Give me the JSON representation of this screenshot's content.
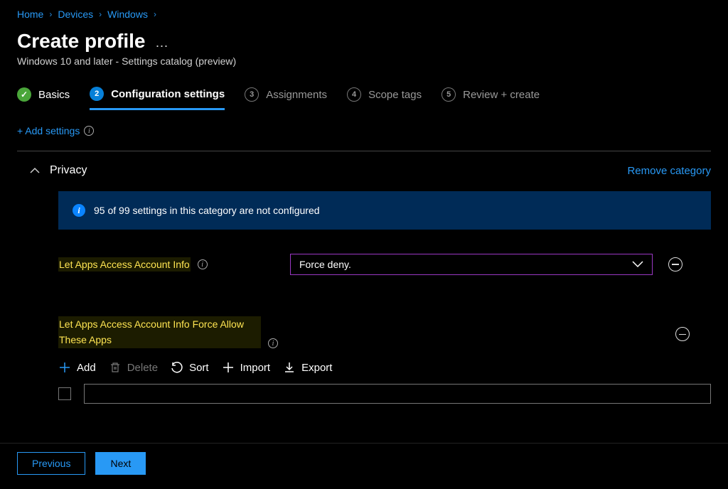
{
  "breadcrumb": {
    "items": [
      "Home",
      "Devices",
      "Windows"
    ]
  },
  "page": {
    "title": "Create profile",
    "subtitle": "Windows 10 and later - Settings catalog (preview)"
  },
  "wizard": {
    "steps": [
      {
        "label": "Basics"
      },
      {
        "num": "2",
        "label": "Configuration settings"
      },
      {
        "num": "3",
        "label": "Assignments"
      },
      {
        "num": "4",
        "label": "Scope tags"
      },
      {
        "num": "5",
        "label": "Review + create"
      }
    ]
  },
  "actions": {
    "add_settings": "+ Add settings"
  },
  "category": {
    "title": "Privacy",
    "remove": "Remove category",
    "info": "95 of 99 settings in this category are not configured"
  },
  "settings": {
    "s1": {
      "label": "Let Apps Access Account Info",
      "value": "Force deny."
    },
    "s2": {
      "label": "Let Apps Access Account Info Force Allow These Apps"
    }
  },
  "toolbar": {
    "add": "Add",
    "delete": "Delete",
    "sort": "Sort",
    "import": "Import",
    "export": "Export"
  },
  "footer": {
    "prev": "Previous",
    "next": "Next"
  }
}
